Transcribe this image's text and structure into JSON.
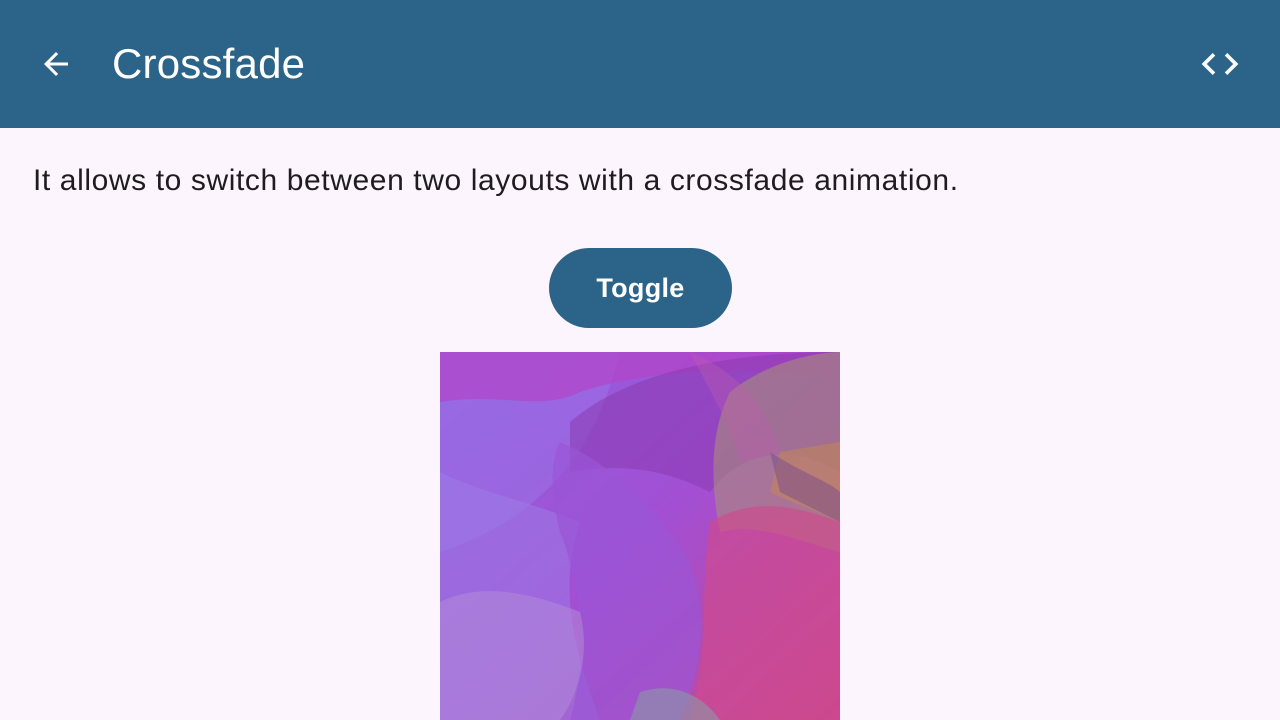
{
  "colors": {
    "primary": "#2b6488",
    "background": "#fdf5fd",
    "on_primary": "#ffffff",
    "text": "#1f1b20"
  },
  "appbar": {
    "title": "Crossfade",
    "back_icon": "arrow-back-icon",
    "code_icon": "code-icon"
  },
  "content": {
    "description": "It allows to switch between two layouts with a crossfade animation.",
    "toggle_label": "Toggle",
    "image_icon": "abstract-gradient-image"
  }
}
